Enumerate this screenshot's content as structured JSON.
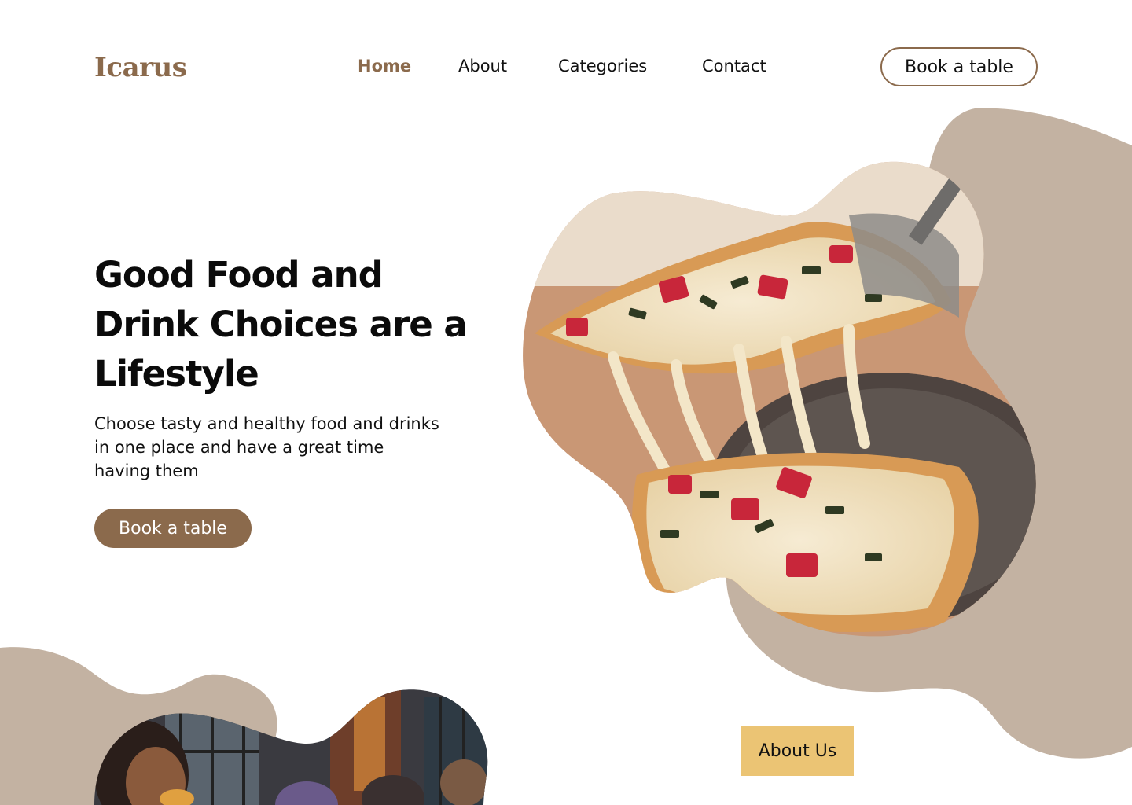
{
  "brand": {
    "logo_text": "Icarus"
  },
  "nav": {
    "items": [
      {
        "label": "Home",
        "active": true
      },
      {
        "label": "About",
        "active": false
      },
      {
        "label": "Categories",
        "active": false
      },
      {
        "label": "Contact",
        "active": false
      }
    ]
  },
  "header": {
    "cta_label": "Book a table"
  },
  "hero": {
    "title_lines": [
      "Good Food and",
      "Drink Choices are a",
      "Lifestyle"
    ],
    "subtitle_lines": [
      "Choose tasty and healthy food and drinks",
      "in one place and have a great time",
      "having them"
    ],
    "cta_label": "Book a table",
    "image": "pizza-slice-photo"
  },
  "about": {
    "badge_label": "About Us",
    "image": "people-eating-photo"
  },
  "colors": {
    "brand_brown": "#8B6A4C",
    "blob_beige": "#C3B2A2",
    "badge_yellow": "#EBC474",
    "text": "#111111",
    "background": "#FFFFFF"
  }
}
